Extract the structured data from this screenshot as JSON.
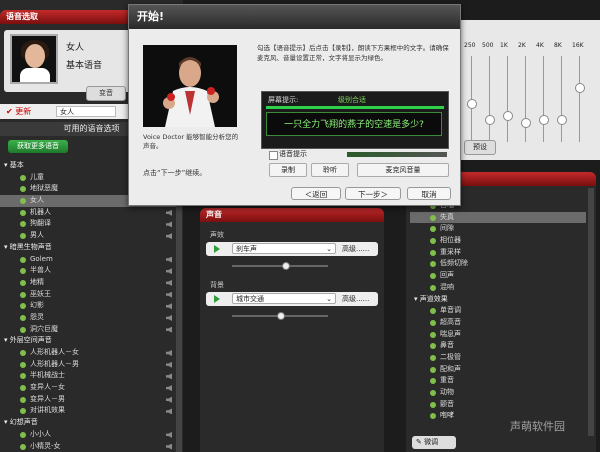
{
  "left": {
    "header": "语音选取",
    "voice_name": "女人",
    "voice_type": "基本语音",
    "change_button": "变音",
    "update_button": "更新",
    "update_value": "女人",
    "available_title": "可用的语音选项",
    "get_more": "获取更多语音",
    "list": [
      {
        "label": "基本",
        "kind": "cat"
      },
      {
        "label": "儿童",
        "kind": "item"
      },
      {
        "label": "地狱恶魔",
        "kind": "item"
      },
      {
        "label": "女人",
        "kind": "item",
        "selected": true
      },
      {
        "label": "机器人",
        "kind": "item"
      },
      {
        "label": "狗翻译",
        "kind": "item"
      },
      {
        "label": "男人",
        "kind": "item"
      },
      {
        "label": "暗黑生物声音",
        "kind": "cat"
      },
      {
        "label": "Golem",
        "kind": "item"
      },
      {
        "label": "半兽人",
        "kind": "item"
      },
      {
        "label": "地精",
        "kind": "item"
      },
      {
        "label": "巫妖王",
        "kind": "item"
      },
      {
        "label": "幻影",
        "kind": "item"
      },
      {
        "label": "怨灵",
        "kind": "item"
      },
      {
        "label": "洞穴巨魔",
        "kind": "item"
      },
      {
        "label": "外层空间声音",
        "kind": "cat"
      },
      {
        "label": "人形机器人－女",
        "kind": "item"
      },
      {
        "label": "人形机器人－男",
        "kind": "item"
      },
      {
        "label": "半机械战士",
        "kind": "item"
      },
      {
        "label": "变异人－女",
        "kind": "item"
      },
      {
        "label": "变异人－男",
        "kind": "item"
      },
      {
        "label": "对讲机效果",
        "kind": "item"
      },
      {
        "label": "幻想声音",
        "kind": "cat"
      },
      {
        "label": "小小人",
        "kind": "item"
      },
      {
        "label": "小精灵-女",
        "kind": "item"
      }
    ]
  },
  "eq": {
    "bands": [
      "250",
      "500",
      "1K",
      "2K",
      "4K",
      "8K",
      "16K"
    ],
    "levels": [
      0.55,
      0.75,
      0.7,
      0.8,
      0.75,
      0.75,
      0.35
    ],
    "preset_button": "预设"
  },
  "sound": {
    "header": "声音",
    "effect_label": "声效",
    "effect_value": "刹车声",
    "effect_adv": "高级......",
    "effect_level": 0.55,
    "bg_label": "背景",
    "bg_value": "城市交通",
    "bg_adv": "高级......",
    "bg_level": 0.5
  },
  "effects": {
    "list": [
      {
        "label": "合唱",
        "kind": "item"
      },
      {
        "label": "失真",
        "kind": "item",
        "selected": true
      },
      {
        "label": "间隙",
        "kind": "item"
      },
      {
        "label": "相位器",
        "kind": "item"
      },
      {
        "label": "重采样",
        "kind": "item"
      },
      {
        "label": "低频切除",
        "kind": "item"
      },
      {
        "label": "回声",
        "kind": "item"
      },
      {
        "label": "混响",
        "kind": "item"
      },
      {
        "label": "声道效果",
        "kind": "cat"
      },
      {
        "label": "单音调",
        "kind": "item"
      },
      {
        "label": "超高音",
        "kind": "item"
      },
      {
        "label": "喘息声",
        "kind": "item"
      },
      {
        "label": "鼻音",
        "kind": "item"
      },
      {
        "label": "二极管",
        "kind": "item"
      },
      {
        "label": "配和声",
        "kind": "item"
      },
      {
        "label": "重音",
        "kind": "item"
      },
      {
        "label": "动物",
        "kind": "item"
      },
      {
        "label": "颤音",
        "kind": "item"
      },
      {
        "label": "咆哮",
        "kind": "item"
      }
    ],
    "tune_button": "微调"
  },
  "dialog": {
    "title": "开始!",
    "instructions": "勾选【语音提示】后点击【录制】，朗读下方果框中的文字。请确保麦克风、音量设置正常，文字将显示为绿色。",
    "screen_prompt_label": "屏幕提示:",
    "level_label": "级别合适",
    "prompt_text": "一只全力飞翔的燕子的空速是多少?",
    "checkbox_label": "语音提示",
    "record_button": "录制",
    "listen_button": "聆听",
    "mic_button": "麦克风音量",
    "vd_description": "Voice Doctor 能够智能分析您的声音。",
    "next_hint": "点击“下一步”继续。",
    "back_button": "＜返回",
    "next_button": "下一步＞",
    "cancel_button": "取消"
  },
  "watermark": "声萌软件园"
}
